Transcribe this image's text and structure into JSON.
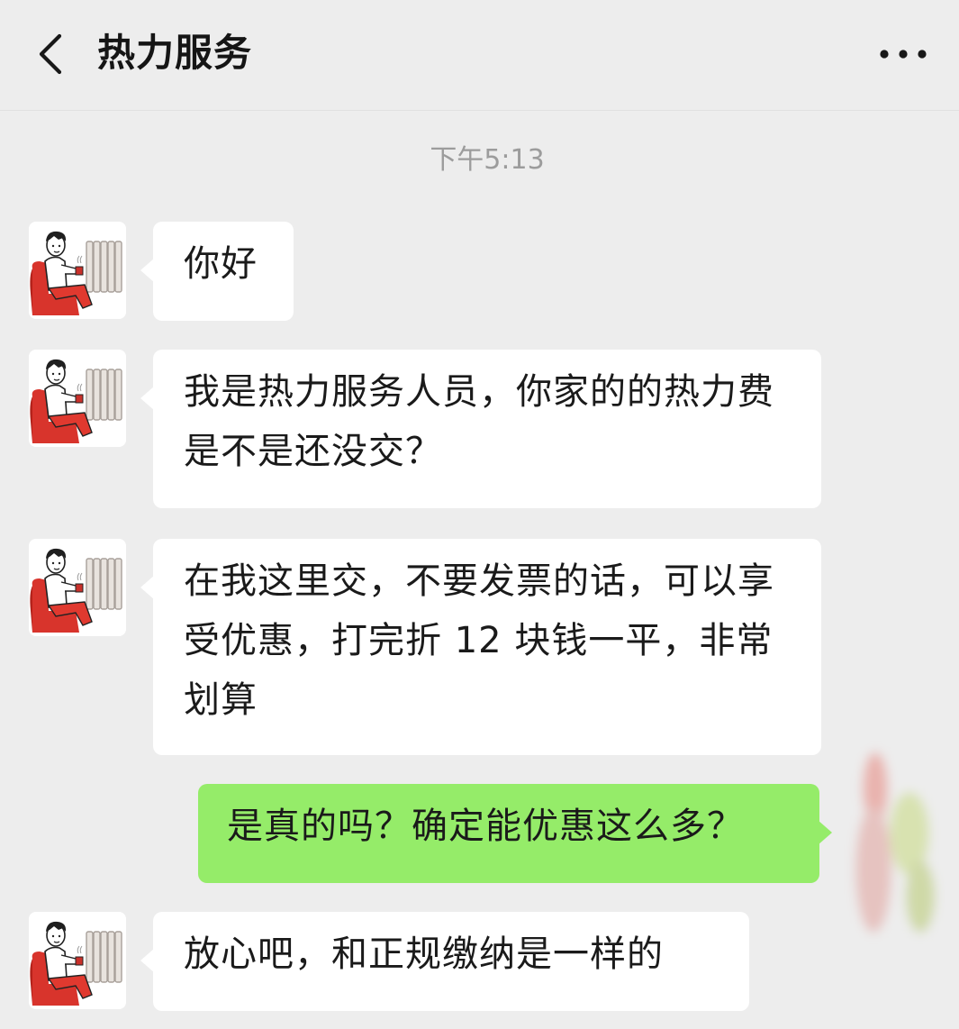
{
  "header": {
    "back_icon": "chevron-left-icon",
    "title": "热力服务",
    "more_icon": "more-horizontal-icon"
  },
  "timestamp": "下午5:13",
  "colors": {
    "background": "#ededed",
    "incoming_bubble": "#ffffff",
    "outgoing_bubble": "#95ec69",
    "timestamp_text": "#9c9c9c"
  },
  "messages": [
    {
      "sender": "incoming",
      "text": "你好"
    },
    {
      "sender": "incoming",
      "text": "我是热力服务人员，你家的的热力费是不是还没交？"
    },
    {
      "sender": "incoming",
      "text": "在我这里交，不要发票的话，可以享受优惠，打完折 12 块钱一平，非常划算"
    },
    {
      "sender": "outgoing",
      "text": "是真的吗？确定能优惠这么多？"
    },
    {
      "sender": "incoming",
      "text": "放心吧，和正规缴纳是一样的"
    }
  ]
}
